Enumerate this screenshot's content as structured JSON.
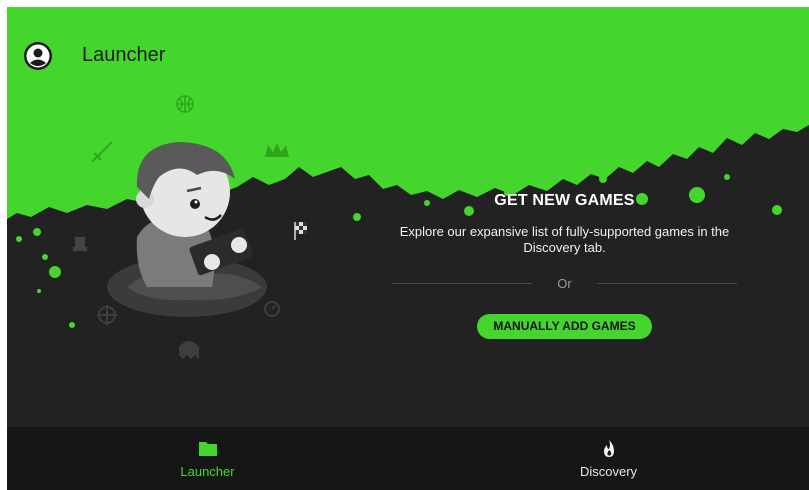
{
  "app": {
    "title": "Launcher"
  },
  "empty_state": {
    "heading": "GET NEW GAMES",
    "description": "Explore our expansive list of fully-supported games in the Discovery tab.",
    "divider_text": "Or",
    "manual_add_label": "MANUALLY ADD GAMES"
  },
  "bottom_nav": {
    "items": [
      {
        "label": "Launcher",
        "icon": "folder-icon",
        "active": true
      },
      {
        "label": "Discovery",
        "icon": "flame-icon",
        "active": false
      }
    ]
  },
  "colors": {
    "accent": "#44d62c",
    "background": "#222222",
    "nav_background": "#161616"
  }
}
